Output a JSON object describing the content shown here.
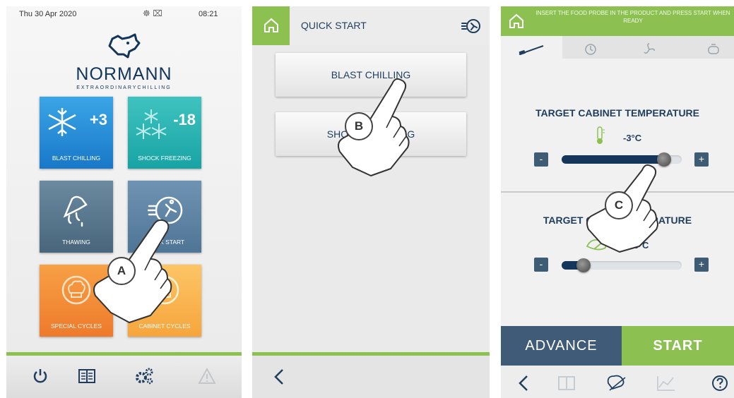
{
  "panel_a": {
    "status": {
      "date": "Thu 30 Apr 2020",
      "time": "08:21",
      "icons": "☸ ⌧"
    },
    "brand": "NORMANN",
    "tagline": "EXTRAORDINARYCHILLING",
    "tiles": {
      "blast": {
        "label": "BLAST CHILLING",
        "temp": "+3"
      },
      "shock": {
        "label": "SHOCK FREEZING",
        "temp": "-18"
      },
      "thawing": {
        "label": "THAWING"
      },
      "quick": {
        "label": "QUICK START"
      },
      "special": {
        "label": "SPECIAL CYCLES"
      },
      "cabinet": {
        "label": "CABINET CYCLES"
      }
    },
    "bottom_icons": [
      "power-icon",
      "book-icon",
      "gears-icon",
      "warning-icon"
    ],
    "callout": "A",
    "colors": {
      "blast": "#1978c9",
      "shock": "#18a3a4",
      "thawing": "#48657c",
      "quick": "#4f7596",
      "special": "#ee7a2b",
      "cabinet": "#f7a53c",
      "green": "#8cc152",
      "navy": "#1f3e5e"
    }
  },
  "panel_b": {
    "title": "QUICK START",
    "buttons": [
      "BLAST CHILLING",
      "SHOCK FREEZING"
    ],
    "callout": "B"
  },
  "panel_c": {
    "banner": "INSERT THE FOOD PROBE IN THE PRODUCT AND PRESS START WHEN READY",
    "tabs": [
      "probe-icon",
      "clock-icon",
      "fan-icon",
      "compressor-icon"
    ],
    "cabinet": {
      "heading": "TARGET CABINET TEMPERATURE",
      "value": "-3°C",
      "level": 0.85
    },
    "core": {
      "heading": "TARGET CORE TEMPERATURE",
      "value": "+3°C",
      "level": 0.18
    },
    "minus": "-",
    "plus": "+",
    "advance": "ADVANCE",
    "start": "START",
    "bottom_icons": [
      "back-icon",
      "book-icon",
      "recipe-icon",
      "chart-icon",
      "help-icon"
    ],
    "callout": "C"
  }
}
